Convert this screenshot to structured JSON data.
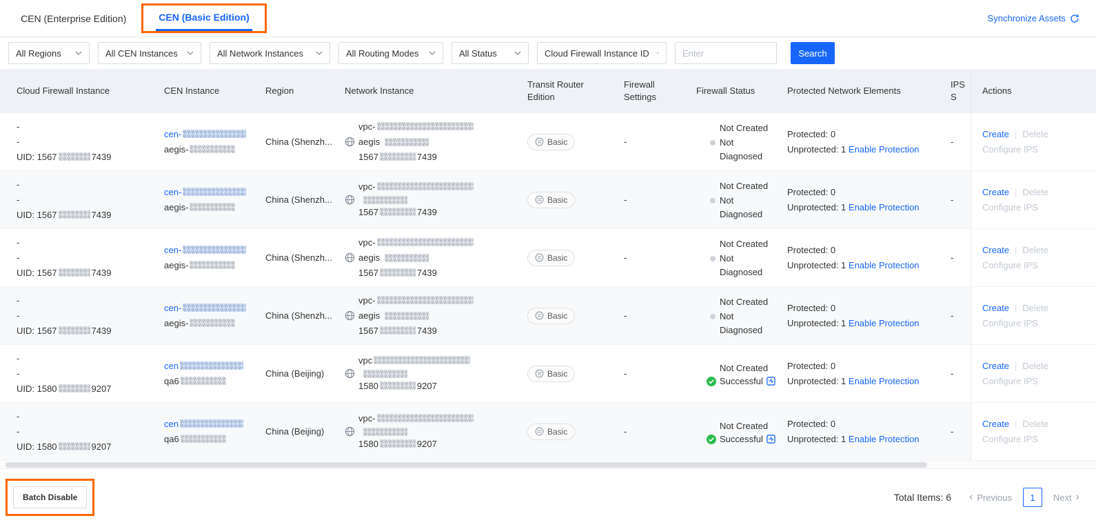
{
  "colors": {
    "accent_blue": "#1766f9",
    "annotation_orange": "#ff6600",
    "success_green": "#2bbc50",
    "header_bg": "#eef2f7"
  },
  "tabs": [
    {
      "label": "CEN (Enterprise Edition)",
      "active": false
    },
    {
      "label": "CEN (Basic Edition)",
      "active": true
    }
  ],
  "header": {
    "synchronize_assets": "Synchronize Assets"
  },
  "filters": {
    "dropdowns": [
      "All Regions",
      "All CEN Instances",
      "All Network Instances",
      "All Routing Modes",
      "All Status",
      "Cloud Firewall Instance ID"
    ],
    "input_placeholder": "Enter",
    "search_label": "Search"
  },
  "table": {
    "columns": [
      "Cloud Firewall Instance",
      "CEN Instance",
      "Region",
      "Network Instance",
      "Transit Router Edition",
      "Firewall Settings",
      "Firewall Status",
      "Protected Network Elements",
      "IPS S",
      "Actions"
    ],
    "labels": {
      "create": "Create",
      "divider": "|",
      "delete": "Delete",
      "configure_ips": "Configure IPS",
      "enable_protection": "Enable Protection"
    },
    "rows": [
      {
        "cfw_line1": "-",
        "cfw_line2": "-",
        "uid_prefix": "UID: 1567",
        "uid_suffix": "7439",
        "cen_prefix": "cen-",
        "cen_sub_prefix": "aegis-",
        "region": "China (Shenzh...",
        "vpc_prefix": "vpc-",
        "net_prefix": "aegis",
        "net_num_prefix": "1567",
        "net_num_suffix": "7439",
        "transit_router": "Basic",
        "firewall_settings": "-",
        "status_created": "Not Created",
        "status_detail": "Not Diagnosed",
        "status_ok": false,
        "protected_label": "Protected: 0",
        "unprotected_label": "Unprotected: 1",
        "ips": "-"
      },
      {
        "cfw_line1": "-",
        "cfw_line2": "-",
        "uid_prefix": "UID: 1567",
        "uid_suffix": "7439",
        "cen_prefix": "cen-",
        "cen_sub_prefix": "aegis-",
        "region": "China (Shenzh...",
        "vpc_prefix": "vpc-",
        "net_prefix": "",
        "net_num_prefix": "1567",
        "net_num_suffix": "7439",
        "transit_router": "Basic",
        "firewall_settings": "-",
        "status_created": "Not Created",
        "status_detail": "Not Diagnosed",
        "status_ok": false,
        "protected_label": "Protected: 0",
        "unprotected_label": "Unprotected: 1",
        "ips": "-"
      },
      {
        "cfw_line1": "-",
        "cfw_line2": "-",
        "uid_prefix": "UID: 1567",
        "uid_suffix": "7439",
        "cen_prefix": "cen-",
        "cen_sub_prefix": "aegis-",
        "region": "China (Shenzh...",
        "vpc_prefix": "vpc-",
        "net_prefix": "aegis",
        "net_num_prefix": "1567",
        "net_num_suffix": "7439",
        "transit_router": "Basic",
        "firewall_settings": "-",
        "status_created": "Not Created",
        "status_detail": "Not Diagnosed",
        "status_ok": false,
        "protected_label": "Protected: 0",
        "unprotected_label": "Unprotected: 1",
        "ips": "-"
      },
      {
        "cfw_line1": "-",
        "cfw_line2": "-",
        "uid_prefix": "UID: 1567",
        "uid_suffix": "7439",
        "cen_prefix": "cen-",
        "cen_sub_prefix": "aegis-",
        "region": "China (Shenzh...",
        "vpc_prefix": "vpc-",
        "net_prefix": "aegis",
        "net_num_prefix": "1567",
        "net_num_suffix": "7439",
        "transit_router": "Basic",
        "firewall_settings": "-",
        "status_created": "Not Created",
        "status_detail": "Not Diagnosed",
        "status_ok": false,
        "protected_label": "Protected: 0",
        "unprotected_label": "Unprotected: 1",
        "ips": "-"
      },
      {
        "cfw_line1": "-",
        "cfw_line2": "-",
        "uid_prefix": "UID: 1580",
        "uid_suffix": "9207",
        "cen_prefix": "cen",
        "cen_sub_prefix": "qa6",
        "region": "China (Beijing)",
        "vpc_prefix": "vpc",
        "net_prefix": "",
        "net_num_prefix": "1580",
        "net_num_suffix": "9207",
        "transit_router": "Basic",
        "firewall_settings": "-",
        "status_created": "Not Created",
        "status_detail": "Successful",
        "status_ok": true,
        "protected_label": "Protected: 0",
        "unprotected_label": "Unprotected: 1",
        "ips": "-"
      },
      {
        "cfw_line1": "-",
        "cfw_line2": "-",
        "uid_prefix": "UID: 1580",
        "uid_suffix": "9207",
        "cen_prefix": "cen",
        "cen_sub_prefix": "qa6",
        "region": "China (Beijing)",
        "vpc_prefix": "vpc-",
        "net_prefix": "",
        "net_num_prefix": "1580",
        "net_num_suffix": "9207",
        "transit_router": "Basic",
        "firewall_settings": "-",
        "status_created": "Not Created",
        "status_detail": "Successful",
        "status_ok": true,
        "protected_label": "Protected: 0",
        "unprotected_label": "Unprotected: 1",
        "ips": "-"
      }
    ]
  },
  "footer": {
    "batch_disable": "Batch Disable",
    "total_items": "Total Items: 6",
    "previous": "Previous",
    "page": "1",
    "next": "Next"
  }
}
